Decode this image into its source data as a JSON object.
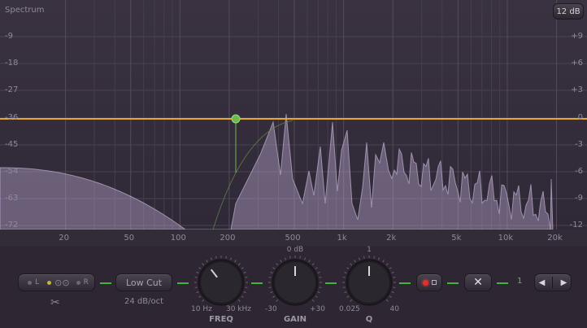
{
  "display": {
    "title": "Spectrum",
    "range_label": "12 dB",
    "db_left": [
      "-9",
      "-18",
      "-27",
      "-36",
      "-45",
      "-54",
      "-63",
      "-72"
    ],
    "db_right": [
      "+9",
      "+6",
      "+3",
      "0",
      "-3",
      "-6",
      "-9",
      "-12"
    ],
    "freq_labels": [
      "20",
      "50",
      "100",
      "200",
      "500",
      "1k",
      "2k",
      "5k",
      "10k",
      "20k"
    ],
    "band_color": "#e6a82a",
    "node_color": "#6fb84c"
  },
  "controls": {
    "stereo": {
      "left": "L",
      "right": "R"
    },
    "filter_type": "Low Cut",
    "slope": "24 dB/oct",
    "knobs": [
      {
        "title": "FREQ",
        "min": "10 Hz",
        "max": "30 kHz",
        "top": "",
        "level": 0.36
      },
      {
        "title": "GAIN",
        "min": "-30",
        "max": "+30",
        "top": "0 dB",
        "level": 0.5
      },
      {
        "title": "Q",
        "min": "0.025",
        "max": "40",
        "top": "1",
        "level": 0.5
      }
    ],
    "band_number": "1",
    "accent": "#3fb43f"
  }
}
